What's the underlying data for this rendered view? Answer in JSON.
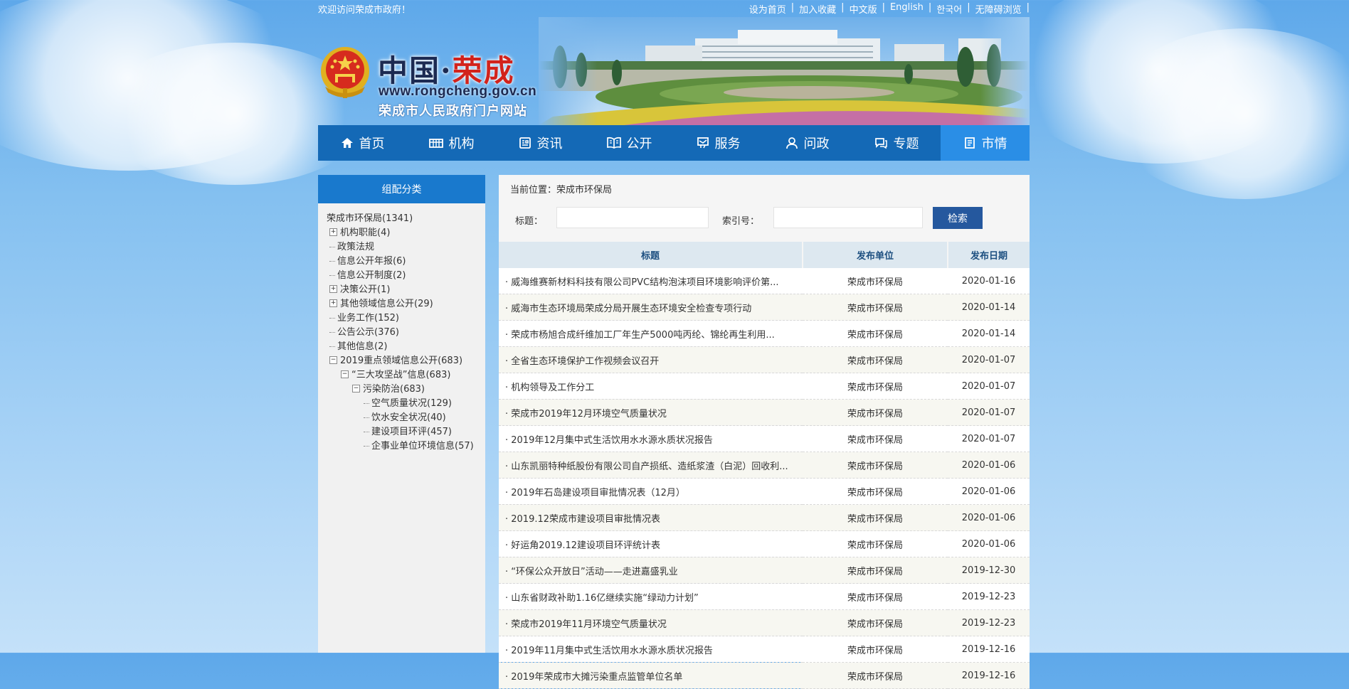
{
  "topbar": {
    "welcome": "欢迎访问荣成市政府！",
    "links": [
      "设为首页",
      "加入收藏",
      "中文版",
      "English",
      "한국어",
      "无障碍浏览"
    ]
  },
  "logo": {
    "title_a": "中国·",
    "title_b": "荣成",
    "url": "www.rongcheng.gov.cn",
    "subtitle": "荣成市人民政府门户网站"
  },
  "nav": [
    {
      "label": "首页",
      "icon": "home-icon"
    },
    {
      "label": "机构",
      "icon": "building-icon"
    },
    {
      "label": "资讯",
      "icon": "news-icon"
    },
    {
      "label": "公开",
      "icon": "book-icon"
    },
    {
      "label": "服务",
      "icon": "service-icon"
    },
    {
      "label": "问政",
      "icon": "user-icon"
    },
    {
      "label": "专题",
      "icon": "chat-icon"
    },
    {
      "label": "市情",
      "icon": "document-icon"
    }
  ],
  "sidebar": {
    "heading": "组配分类",
    "tree": [
      {
        "label": "荣成市环保局(1341)",
        "level": 0,
        "toggle": ""
      },
      {
        "label": "机构职能(4)",
        "level": 1,
        "toggle": "+"
      },
      {
        "label": "政策法规",
        "level": 1,
        "toggle": "-"
      },
      {
        "label": "信息公开年报(6)",
        "level": 1,
        "toggle": "-"
      },
      {
        "label": "信息公开制度(2)",
        "level": 1,
        "toggle": "-"
      },
      {
        "label": "决策公开(1)",
        "level": 1,
        "toggle": "+"
      },
      {
        "label": "其他领域信息公开(29)",
        "level": 1,
        "toggle": "+"
      },
      {
        "label": "业务工作(152)",
        "level": 1,
        "toggle": "-"
      },
      {
        "label": "公告公示(376)",
        "level": 1,
        "toggle": "-"
      },
      {
        "label": "其他信息(2)",
        "level": 1,
        "toggle": "-"
      },
      {
        "label": "2019重点领域信息公开(683)",
        "level": 1,
        "toggle": "−"
      },
      {
        "label": "“三大攻坚战”信息(683)",
        "level": 2,
        "toggle": "−"
      },
      {
        "label": "污染防治(683)",
        "level": 3,
        "toggle": "−"
      },
      {
        "label": "空气质量状况(129)",
        "level": 4,
        "toggle": "-"
      },
      {
        "label": "饮水安全状况(40)",
        "level": 4,
        "toggle": "-"
      },
      {
        "label": "建设项目环评(457)",
        "level": 4,
        "toggle": "-"
      },
      {
        "label": "企事业单位环境信息(57)",
        "level": 4,
        "toggle": "-"
      }
    ]
  },
  "main": {
    "breadcrumb": "当前位置：荣成市环保局",
    "search": {
      "title_label": "标题：",
      "index_label": "索引号：",
      "button": "检索"
    },
    "columns": [
      "标题",
      "发布单位",
      "发布日期"
    ],
    "rows": [
      {
        "title": "· 威海维赛新材料科技有限公司PVC结构泡沫项目环境影响评价第...",
        "unit": "荣成市环保局",
        "date": "2020-01-16"
      },
      {
        "title": "· 威海市生态环境局荣成分局开展生态环境安全检查专项行动",
        "unit": "荣成市环保局",
        "date": "2020-01-14"
      },
      {
        "title": "· 荣成市杨旭合成纤维加工厂年生产5000吨丙纶、锦纶再生利用...",
        "unit": "荣成市环保局",
        "date": "2020-01-14"
      },
      {
        "title": "· 全省生态环境保护工作视频会议召开",
        "unit": "荣成市环保局",
        "date": "2020-01-07"
      },
      {
        "title": "· 机构领导及工作分工",
        "unit": "荣成市环保局",
        "date": "2020-01-07"
      },
      {
        "title": "· 荣成市2019年12月环境空气质量状况",
        "unit": "荣成市环保局",
        "date": "2020-01-07"
      },
      {
        "title": "· 2019年12月集中式生活饮用水水源水质状况报告",
        "unit": "荣成市环保局",
        "date": "2020-01-07"
      },
      {
        "title": "· 山东凯丽特种纸股份有限公司自产损纸、造纸浆渣（白泥）回收利...",
        "unit": "荣成市环保局",
        "date": "2020-01-06"
      },
      {
        "title": "· 2019年石岛建设项目审批情况表（12月）",
        "unit": "荣成市环保局",
        "date": "2020-01-06"
      },
      {
        "title": "· 2019.12荣成市建设项目审批情况表",
        "unit": "荣成市环保局",
        "date": "2020-01-06"
      },
      {
        "title": "· 好运角2019.12建设项目环评统计表",
        "unit": "荣成市环保局",
        "date": "2020-01-06"
      },
      {
        "title": "· “环保公众开放日”活动——走进嘉盛乳业",
        "unit": "荣成市环保局",
        "date": "2019-12-30"
      },
      {
        "title": "· 山东省财政补助1.16亿继续实施“绿动力计划”",
        "unit": "荣成市环保局",
        "date": "2019-12-23"
      },
      {
        "title": "· 荣成市2019年11月环境空气质量状况",
        "unit": "荣成市环保局",
        "date": "2019-12-23"
      },
      {
        "title": "· 2019年11月集中式生活饮用水水源水质状况报告",
        "unit": "荣成市环保局",
        "date": "2019-12-16"
      },
      {
        "title": "· 2019年荣成市大摊污染重点监管单位名单",
        "unit": "荣成市环保局",
        "date": "2019-12-16"
      }
    ]
  },
  "colors": {
    "nav_bg": "#1469b6",
    "nav_active": "#2a8ee6",
    "sidebar_head": "#1979cd",
    "search_button": "#25589e",
    "table_head": "#dde8f0"
  }
}
